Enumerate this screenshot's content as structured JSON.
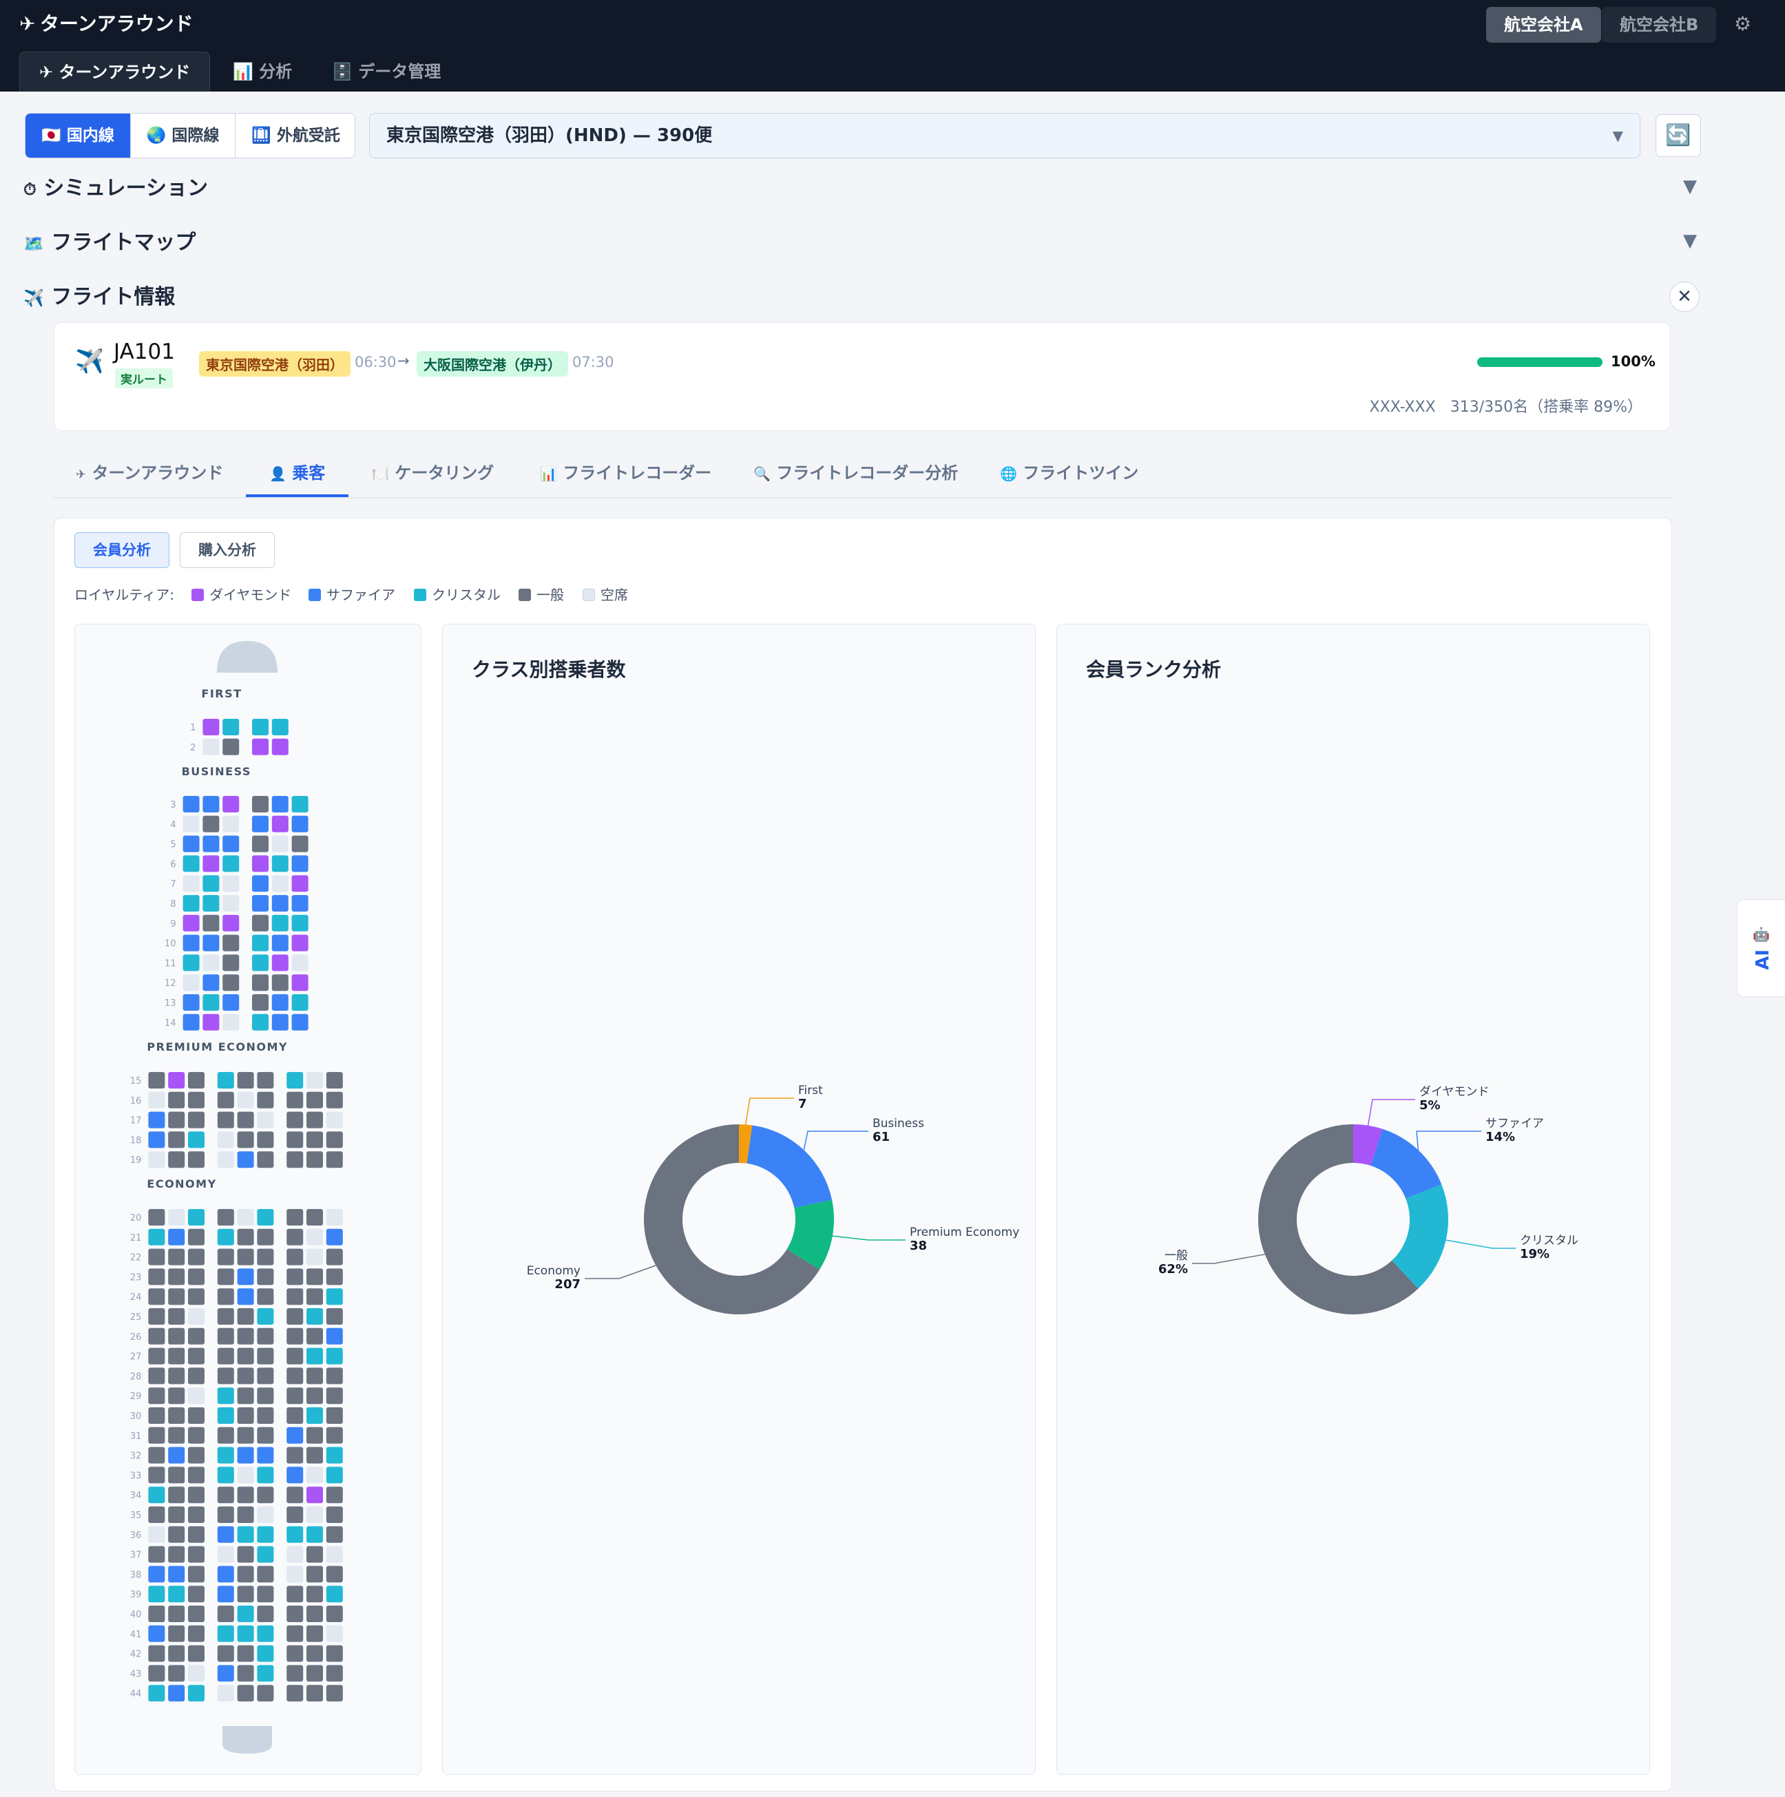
{
  "app": {
    "title_glyph": "✈",
    "title": "ターンアラウンド",
    "airlines": [
      "航空会社A",
      "航空会社B"
    ],
    "settings_icon": "⚙"
  },
  "nav": {
    "tabs": [
      {
        "icon": "✈",
        "label": "ターンアラウンド",
        "active": true
      },
      {
        "icon": "📊",
        "label": "分析",
        "active": false
      },
      {
        "icon": "🗄️",
        "label": "データ管理",
        "active": false
      }
    ]
  },
  "filters": {
    "segments": [
      {
        "icon": "🇯🇵",
        "label": "国内線",
        "active": true
      },
      {
        "icon": "🌏",
        "label": "国際線",
        "active": false
      },
      {
        "icon": "🛄",
        "label": "外航受託",
        "active": false
      }
    ],
    "airport_select": "東京国際空港（羽田）(HND) — 390便",
    "refresh_icon": "🔄"
  },
  "sections": {
    "simulation": {
      "icon": "⏱",
      "label": "シミュレーション",
      "toggle": "▼"
    },
    "flight_map": {
      "icon": "🗺️",
      "label": "フライトマップ",
      "toggle": "▼"
    },
    "flight_info": {
      "icon": "✈️",
      "label": "フライト情報",
      "close": "✕"
    }
  },
  "flight": {
    "icon": "✈️",
    "number": "JA101",
    "route_badge": "実ルート",
    "departure_airport": "東京国際空港（羽田）",
    "departure_time": "06:30",
    "arrow": "→",
    "arrival_airport": "大阪国際空港（伊丹）",
    "arrival_time": "07:30",
    "progress": 1.0,
    "progress_label": "100%",
    "meta": "XXX-XXX   313/350名（搭乗率 89%）"
  },
  "subtabs": [
    {
      "icon": "✈",
      "label": "ターンアラウンド",
      "active": false
    },
    {
      "icon": "👤",
      "label": "乗客",
      "active": true
    },
    {
      "icon": "🍽️",
      "label": "ケータリング",
      "active": false
    },
    {
      "icon": "📊",
      "label": "フライトレコーダー",
      "active": false
    },
    {
      "icon": "🔍",
      "label": "フライトレコーダー分析",
      "active": false
    },
    {
      "icon": "🌐",
      "label": "フライトツイン",
      "active": false
    }
  ],
  "analysis_buttons": [
    {
      "label": "会員分析",
      "active": true
    },
    {
      "label": "購入分析",
      "active": false
    }
  ],
  "legend": {
    "label": "ロイヤルティア:",
    "items": [
      {
        "label": "ダイヤモンド",
        "color": "#a855f7"
      },
      {
        "label": "サファイア",
        "color": "#3b82f6"
      },
      {
        "label": "クリスタル",
        "color": "#22b8d4"
      },
      {
        "label": "一般",
        "color": "#6b7280"
      },
      {
        "label": "空席",
        "color": "#e2e8f0"
      }
    ]
  },
  "seat_colors": {
    "D": "#a855f7",
    "S": "#3b82f6",
    "C": "#22b8d4",
    "G": "#6b7280",
    "E": "#e2e8f0"
  },
  "seatmap": {
    "cabins": [
      {
        "name": "FIRST",
        "groups": [
          2,
          2
        ],
        "rows": [
          {
            "row": 1,
            "seats": "DCCC"
          },
          {
            "row": 2,
            "seats": "EGDD"
          }
        ]
      },
      {
        "name": "BUSINESS",
        "groups": [
          3,
          3
        ],
        "rows": [
          {
            "row": 3,
            "seats": "SSDGSC"
          },
          {
            "row": 4,
            "seats": "EGESDS"
          },
          {
            "row": 5,
            "seats": "SSSGEG"
          },
          {
            "row": 6,
            "seats": "CDCDCS"
          },
          {
            "row": 7,
            "seats": "ECESED"
          },
          {
            "row": 8,
            "seats": "CCESSS"
          },
          {
            "row": 9,
            "seats": "DGDGCC"
          },
          {
            "row": 10,
            "seats": "SSGCSD"
          },
          {
            "row": 11,
            "seats": "CEGCDE"
          },
          {
            "row": 12,
            "seats": "ESGGGD"
          },
          {
            "row": 13,
            "seats": "SCSGSC"
          },
          {
            "row": 14,
            "seats": "SDECSS"
          }
        ]
      },
      {
        "name": "PREMIUM ECONOMY",
        "groups": [
          3,
          3,
          3
        ],
        "rows": [
          {
            "row": 15,
            "seats": "GDGCGGCEG"
          },
          {
            "row": 16,
            "seats": "EGGGEGGGG"
          },
          {
            "row": 17,
            "seats": "SGGGGEGGE"
          },
          {
            "row": 18,
            "seats": "SGCEGGGGG"
          },
          {
            "row": 19,
            "seats": "EGGESGGGG"
          }
        ]
      },
      {
        "name": "ECONOMY",
        "groups": [
          3,
          3,
          3
        ],
        "rows": [
          {
            "row": 20,
            "seats": "GECGECGGE"
          },
          {
            "row": 21,
            "seats": "CSGCGGGES"
          },
          {
            "row": 22,
            "seats": "GGGGGGGEG"
          },
          {
            "row": 23,
            "seats": "GGGGSGGGG"
          },
          {
            "row": 24,
            "seats": "GGGGSGGGC"
          },
          {
            "row": 25,
            "seats": "GGEGGCGCG"
          },
          {
            "row": 26,
            "seats": "GGGGGGGGS"
          },
          {
            "row": 27,
            "seats": "GGGGGGGCC"
          },
          {
            "row": 28,
            "seats": "GGGGGGGGG"
          },
          {
            "row": 29,
            "seats": "GGECGGGGG"
          },
          {
            "row": 30,
            "seats": "GGGCGGGCG"
          },
          {
            "row": 31,
            "seats": "GGGGGGSGG"
          },
          {
            "row": 32,
            "seats": "GSGCSSGGC"
          },
          {
            "row": 33,
            "seats": "GGGCECSEC"
          },
          {
            "row": 34,
            "seats": "CGGGGGGDG"
          },
          {
            "row": 35,
            "seats": "GGGGGEGEG"
          },
          {
            "row": 36,
            "seats": "EGGSCCCCG"
          },
          {
            "row": 37,
            "seats": "GGGEGCEGE"
          },
          {
            "row": 38,
            "seats": "SSGSGGEGG"
          },
          {
            "row": 39,
            "seats": "CCGSGGGGC"
          },
          {
            "row": 40,
            "seats": "GGGGCGGGG"
          },
          {
            "row": 41,
            "seats": "SGGCCCGGE"
          },
          {
            "row": 42,
            "seats": "GGGGGCGGG"
          },
          {
            "row": 43,
            "seats": "GGESGCGGG"
          },
          {
            "row": 44,
            "seats": "CSCEGGGGG"
          }
        ]
      }
    ]
  },
  "chart_data": [
    {
      "type": "pie",
      "donut": true,
      "title": "クラス別搭乗者数",
      "categories": [
        "First",
        "Business",
        "Premium Economy",
        "Economy"
      ],
      "values": [
        7,
        61,
        38,
        207
      ],
      "colors": [
        "#f59e0b",
        "#3b82f6",
        "#10b981",
        "#6b7280"
      ],
      "value_labels": [
        "7",
        "61",
        "38",
        "207"
      ]
    },
    {
      "type": "pie",
      "donut": true,
      "title": "会員ランク分析",
      "categories": [
        "ダイヤモンド",
        "サファイア",
        "クリスタル",
        "一般"
      ],
      "values": [
        5,
        14,
        19,
        62
      ],
      "colors": [
        "#a855f7",
        "#3b82f6",
        "#22b8d4",
        "#6b7280"
      ],
      "value_labels": [
        "5%",
        "14%",
        "19%",
        "62%"
      ]
    }
  ],
  "ai_tab": {
    "icon": "🤖",
    "label": "AI"
  }
}
